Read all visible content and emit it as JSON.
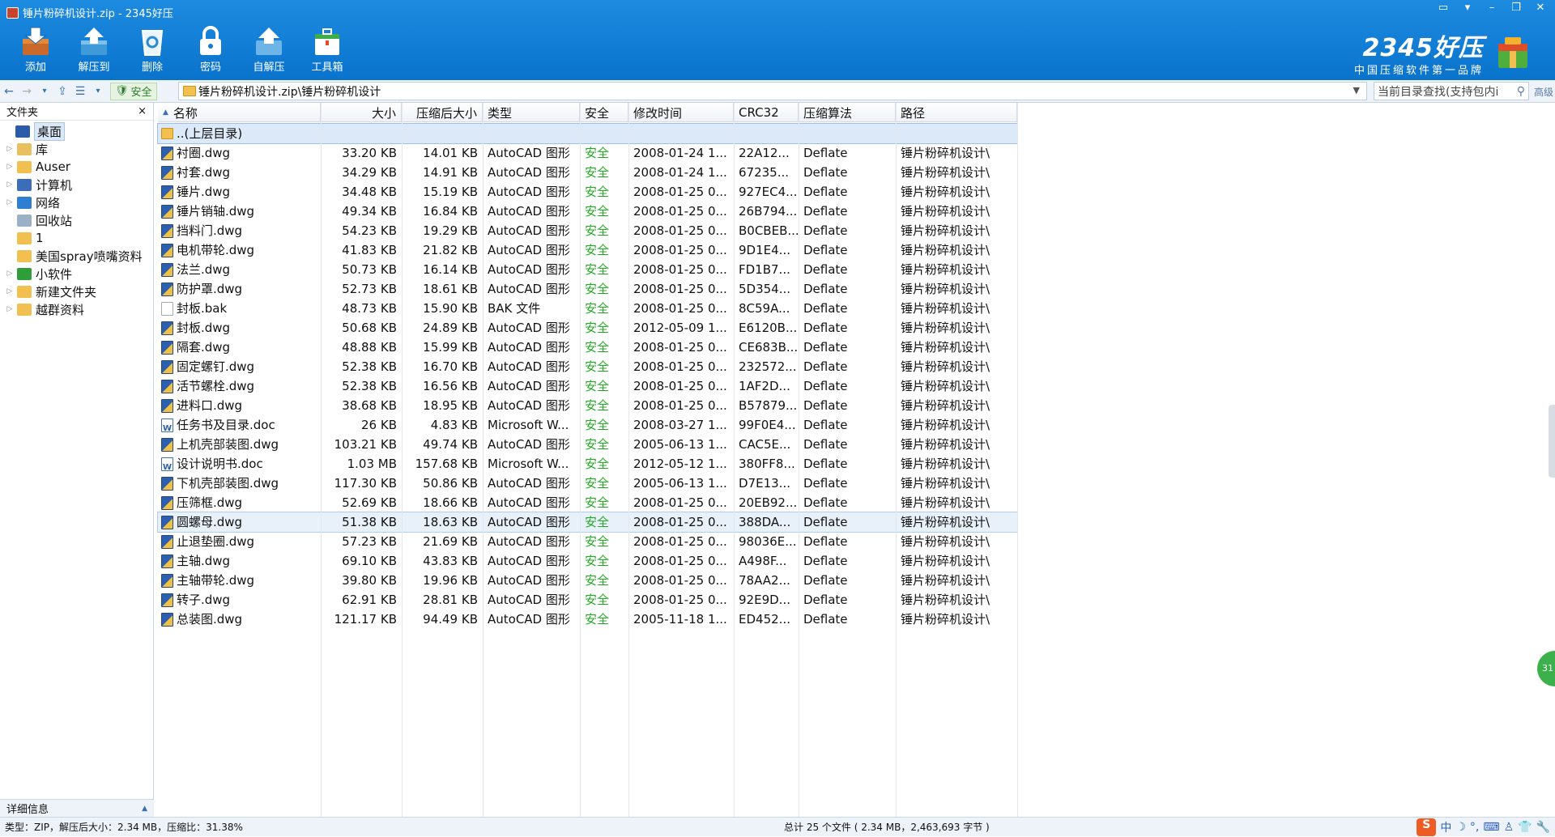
{
  "window": {
    "title": "锤片粉碎机设计.zip - 2345好压",
    "controls": [
      "chat-icon",
      "menu-icon",
      "minimize-icon",
      "restore-icon",
      "close-icon"
    ]
  },
  "toolbar": [
    {
      "label": "添加",
      "icon": "add-icon"
    },
    {
      "label": "解压到",
      "icon": "extract-icon"
    },
    {
      "label": "删除",
      "icon": "recycle-delete-icon"
    },
    {
      "label": "密码",
      "icon": "lock-icon"
    },
    {
      "label": "自解压",
      "icon": "self-extract-icon"
    },
    {
      "label": "工具箱",
      "icon": "toolbox-icon"
    }
  ],
  "logo": {
    "brand": "2345好压",
    "slogan": "中国压缩软件第一品牌"
  },
  "addressbar": {
    "security": "安全",
    "path": "锤片粉碎机设计.zip\\锤片粉碎机设计",
    "search_placeholder": "当前目录查找(支持包内查找)",
    "search_display": "当前目录查找(支持包内i",
    "advanced": "高级"
  },
  "sidebar": {
    "header": "文件夹",
    "close": "×",
    "items": [
      {
        "label": "桌面",
        "expander": false,
        "selected": true,
        "color": "#2a5caa"
      },
      {
        "label": "库",
        "expander": true,
        "color": "#e8c060"
      },
      {
        "label": "Auser",
        "expander": true,
        "color": "#f2c050"
      },
      {
        "label": "计算机",
        "expander": true,
        "color": "#3b6db8"
      },
      {
        "label": "网络",
        "expander": true,
        "color": "#2e7fd1"
      },
      {
        "label": "回收站",
        "expander": false,
        "color": "#9bb0c4"
      },
      {
        "label": "1",
        "expander": false,
        "color": "#f2c050"
      },
      {
        "label": "美国spray喷嘴资料",
        "expander": false,
        "color": "#f2c050"
      },
      {
        "label": "小软件",
        "expander": true,
        "color": "#2f9e3a"
      },
      {
        "label": "新建文件夹",
        "expander": true,
        "color": "#f2c050"
      },
      {
        "label": "越群资料",
        "expander": true,
        "color": "#f2c050"
      }
    ],
    "details": "详细信息",
    "details_arrow": "▲"
  },
  "columns": [
    "名称",
    "大小",
    "压缩后大小",
    "类型",
    "安全",
    "修改时间",
    "CRC32",
    "压缩算法",
    "路径"
  ],
  "parent_row": "..(上层目录)",
  "files": [
    {
      "name": "衬圈.dwg",
      "size": "33.20 KB",
      "packed": "14.01 KB",
      "type": "AutoCAD 图形",
      "safe": "安全",
      "mtime": "2008-01-24 1...",
      "crc": "22A12...",
      "method": "Deflate",
      "path": "锤片粉碎机设计\\",
      "icon": "dwg"
    },
    {
      "name": "衬套.dwg",
      "size": "34.29 KB",
      "packed": "14.91 KB",
      "type": "AutoCAD 图形",
      "safe": "安全",
      "mtime": "2008-01-24 1...",
      "crc": "67235...",
      "method": "Deflate",
      "path": "锤片粉碎机设计\\",
      "icon": "dwg"
    },
    {
      "name": "锤片.dwg",
      "size": "34.48 KB",
      "packed": "15.19 KB",
      "type": "AutoCAD 图形",
      "safe": "安全",
      "mtime": "2008-01-25 0...",
      "crc": "927EC4...",
      "method": "Deflate",
      "path": "锤片粉碎机设计\\",
      "icon": "dwg"
    },
    {
      "name": "锤片销轴.dwg",
      "size": "49.34 KB",
      "packed": "16.84 KB",
      "type": "AutoCAD 图形",
      "safe": "安全",
      "mtime": "2008-01-25 0...",
      "crc": "26B794...",
      "method": "Deflate",
      "path": "锤片粉碎机设计\\",
      "icon": "dwg"
    },
    {
      "name": "挡料门.dwg",
      "size": "54.23 KB",
      "packed": "19.29 KB",
      "type": "AutoCAD 图形",
      "safe": "安全",
      "mtime": "2008-01-25 0...",
      "crc": "B0CBEB...",
      "method": "Deflate",
      "path": "锤片粉碎机设计\\",
      "icon": "dwg"
    },
    {
      "name": "电机带轮.dwg",
      "size": "41.83 KB",
      "packed": "21.82 KB",
      "type": "AutoCAD 图形",
      "safe": "安全",
      "mtime": "2008-01-25 0...",
      "crc": "9D1E4...",
      "method": "Deflate",
      "path": "锤片粉碎机设计\\",
      "icon": "dwg"
    },
    {
      "name": "法兰.dwg",
      "size": "50.73 KB",
      "packed": "16.14 KB",
      "type": "AutoCAD 图形",
      "safe": "安全",
      "mtime": "2008-01-25 0...",
      "crc": "FD1B7...",
      "method": "Deflate",
      "path": "锤片粉碎机设计\\",
      "icon": "dwg"
    },
    {
      "name": "防护罩.dwg",
      "size": "52.73 KB",
      "packed": "18.61 KB",
      "type": "AutoCAD 图形",
      "safe": "安全",
      "mtime": "2008-01-25 0...",
      "crc": "5D354...",
      "method": "Deflate",
      "path": "锤片粉碎机设计\\",
      "icon": "dwg"
    },
    {
      "name": "封板.bak",
      "size": "48.73 KB",
      "packed": "15.90 KB",
      "type": "BAK 文件",
      "safe": "安全",
      "mtime": "2008-01-25 0...",
      "crc": "8C59A...",
      "method": "Deflate",
      "path": "锤片粉碎机设计\\",
      "icon": "bak"
    },
    {
      "name": "封板.dwg",
      "size": "50.68 KB",
      "packed": "24.89 KB",
      "type": "AutoCAD 图形",
      "safe": "安全",
      "mtime": "2012-05-09 1...",
      "crc": "E6120B...",
      "method": "Deflate",
      "path": "锤片粉碎机设计\\",
      "icon": "dwg"
    },
    {
      "name": "隔套.dwg",
      "size": "48.88 KB",
      "packed": "15.99 KB",
      "type": "AutoCAD 图形",
      "safe": "安全",
      "mtime": "2008-01-25 0...",
      "crc": "CE683B...",
      "method": "Deflate",
      "path": "锤片粉碎机设计\\",
      "icon": "dwg"
    },
    {
      "name": "固定螺钉.dwg",
      "size": "52.38 KB",
      "packed": "16.70 KB",
      "type": "AutoCAD 图形",
      "safe": "安全",
      "mtime": "2008-01-25 0...",
      "crc": "232572...",
      "method": "Deflate",
      "path": "锤片粉碎机设计\\",
      "icon": "dwg"
    },
    {
      "name": "活节螺栓.dwg",
      "size": "52.38 KB",
      "packed": "16.56 KB",
      "type": "AutoCAD 图形",
      "safe": "安全",
      "mtime": "2008-01-25 0...",
      "crc": "1AF2D...",
      "method": "Deflate",
      "path": "锤片粉碎机设计\\",
      "icon": "dwg"
    },
    {
      "name": "进料口.dwg",
      "size": "38.68 KB",
      "packed": "18.95 KB",
      "type": "AutoCAD 图形",
      "safe": "安全",
      "mtime": "2008-01-25 0...",
      "crc": "B57879...",
      "method": "Deflate",
      "path": "锤片粉碎机设计\\",
      "icon": "dwg"
    },
    {
      "name": "任务书及目录.doc",
      "size": "26 KB",
      "packed": "4.83 KB",
      "type": "Microsoft W...",
      "safe": "安全",
      "mtime": "2008-03-27 1...",
      "crc": "99F0E4...",
      "method": "Deflate",
      "path": "锤片粉碎机设计\\",
      "icon": "doc"
    },
    {
      "name": "上机壳部装图.dwg",
      "size": "103.21 KB",
      "packed": "49.74 KB",
      "type": "AutoCAD 图形",
      "safe": "安全",
      "mtime": "2005-06-13 1...",
      "crc": "CAC5E...",
      "method": "Deflate",
      "path": "锤片粉碎机设计\\",
      "icon": "dwg"
    },
    {
      "name": "设计说明书.doc",
      "size": "1.03 MB",
      "packed": "157.68 KB",
      "type": "Microsoft W...",
      "safe": "安全",
      "mtime": "2012-05-12 1...",
      "crc": "380FF8...",
      "method": "Deflate",
      "path": "锤片粉碎机设计\\",
      "icon": "doc"
    },
    {
      "name": "下机壳部装图.dwg",
      "size": "117.30 KB",
      "packed": "50.86 KB",
      "type": "AutoCAD 图形",
      "safe": "安全",
      "mtime": "2005-06-13 1...",
      "crc": "D7E13...",
      "method": "Deflate",
      "path": "锤片粉碎机设计\\",
      "icon": "dwg"
    },
    {
      "name": "压筛框.dwg",
      "size": "52.69 KB",
      "packed": "18.66 KB",
      "type": "AutoCAD 图形",
      "safe": "安全",
      "mtime": "2008-01-25 0...",
      "crc": "20EB92...",
      "method": "Deflate",
      "path": "锤片粉碎机设计\\",
      "icon": "dwg"
    },
    {
      "name": "圆螺母.dwg",
      "size": "51.38 KB",
      "packed": "18.63 KB",
      "type": "AutoCAD 图形",
      "safe": "安全",
      "mtime": "2008-01-25 0...",
      "crc": "388DA...",
      "method": "Deflate",
      "path": "锤片粉碎机设计\\",
      "icon": "dwg",
      "selected": true
    },
    {
      "name": "止退垫圈.dwg",
      "size": "57.23 KB",
      "packed": "21.69 KB",
      "type": "AutoCAD 图形",
      "safe": "安全",
      "mtime": "2008-01-25 0...",
      "crc": "98036E...",
      "method": "Deflate",
      "path": "锤片粉碎机设计\\",
      "icon": "dwg"
    },
    {
      "name": "主轴.dwg",
      "size": "69.10 KB",
      "packed": "43.83 KB",
      "type": "AutoCAD 图形",
      "safe": "安全",
      "mtime": "2008-01-25 0...",
      "crc": "A498F...",
      "method": "Deflate",
      "path": "锤片粉碎机设计\\",
      "icon": "dwg"
    },
    {
      "name": "主轴带轮.dwg",
      "size": "39.80 KB",
      "packed": "19.96 KB",
      "type": "AutoCAD 图形",
      "safe": "安全",
      "mtime": "2008-01-25 0...",
      "crc": "78AA2...",
      "method": "Deflate",
      "path": "锤片粉碎机设计\\",
      "icon": "dwg"
    },
    {
      "name": "转子.dwg",
      "size": "62.91 KB",
      "packed": "28.81 KB",
      "type": "AutoCAD 图形",
      "safe": "安全",
      "mtime": "2008-01-25 0...",
      "crc": "92E9D...",
      "method": "Deflate",
      "path": "锤片粉碎机设计\\",
      "icon": "dwg"
    },
    {
      "name": "总装图.dwg",
      "size": "121.17 KB",
      "packed": "94.49 KB",
      "type": "AutoCAD 图形",
      "safe": "安全",
      "mtime": "2005-11-18 1...",
      "crc": "ED452...",
      "method": "Deflate",
      "path": "锤片粉碎机设计\\",
      "icon": "dwg"
    }
  ],
  "status": {
    "left": "类型：ZIP，解压后大小：2.34 MB，压缩比：31.38%",
    "middle": "总计 25 个文件 ( 2.34 MB，2,463,693 字节 )"
  },
  "ime": {
    "logo": "S",
    "mode": "中"
  },
  "badge": "31"
}
